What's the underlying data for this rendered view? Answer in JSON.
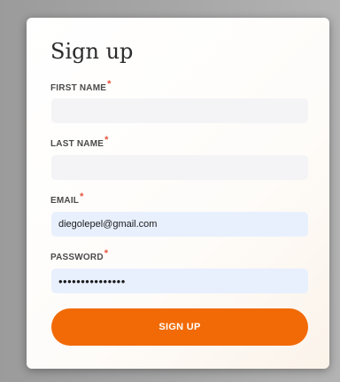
{
  "form": {
    "title": "Sign up",
    "required_marker": "*",
    "first_name": {
      "label": "FIRST NAME",
      "value": "",
      "placeholder": ""
    },
    "last_name": {
      "label": "LAST NAME",
      "value": "",
      "placeholder": ""
    },
    "email": {
      "label": "EMAIL",
      "value": "diegolepel@gmail.com",
      "placeholder": ""
    },
    "password": {
      "label": "PASSWORD",
      "value": "•••••••••••••••",
      "placeholder": ""
    },
    "submit_label": "SIGN UP"
  },
  "colors": {
    "accent": "#f16a06",
    "required": "#e8503a",
    "autofill_bg": "#e8f0fe",
    "input_bg": "#f4f4f6"
  }
}
